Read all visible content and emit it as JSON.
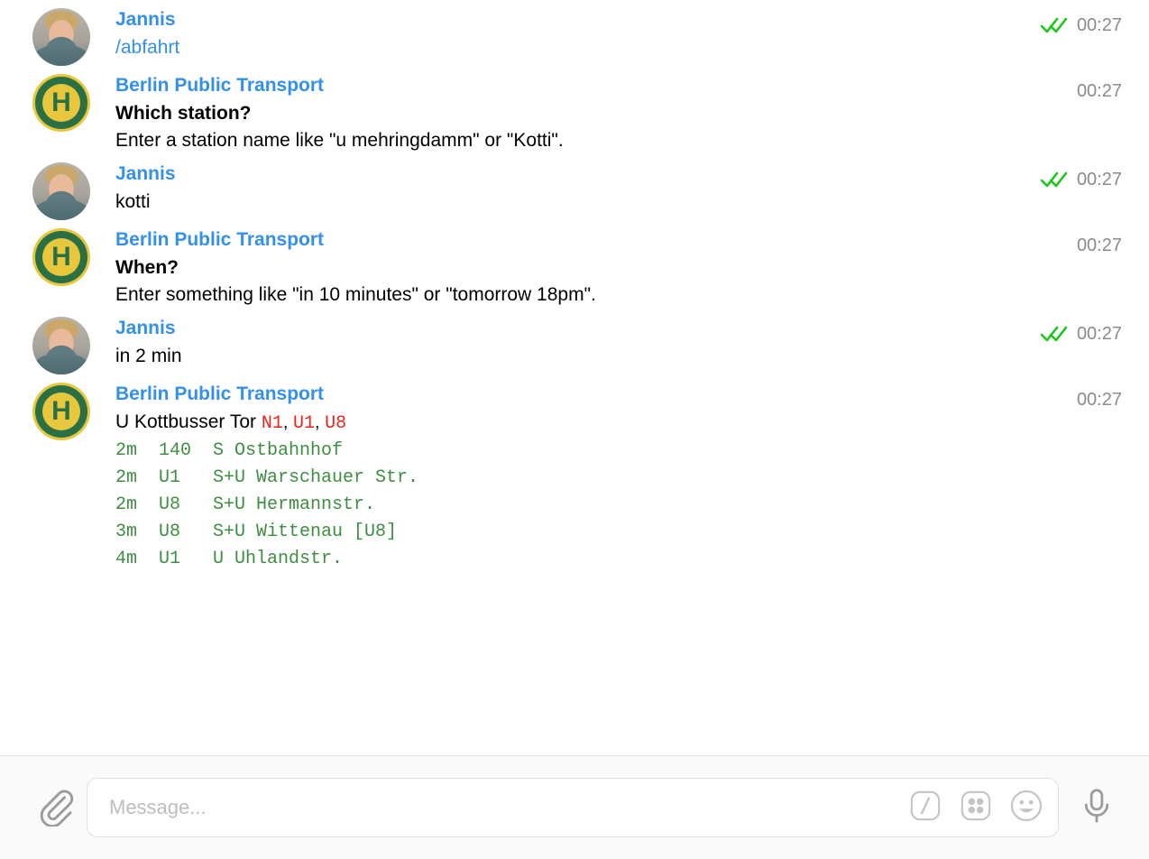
{
  "messages": [
    {
      "sender": "Jannis",
      "avatar": "photo-avatar",
      "text": "/abfahrt",
      "style": "command",
      "time": "00:27",
      "read": true
    },
    {
      "sender": "Berlin Public Transport",
      "avatar": "bus-stop-h-icon",
      "title": "Which station?",
      "text": "Enter a station name like \"u mehringdamm\" or \"Kotti\".",
      "style": "bot-prompt",
      "time": "00:27",
      "read": false
    },
    {
      "sender": "Jannis",
      "avatar": "photo-avatar",
      "text": "kotti",
      "style": "plain",
      "time": "00:27",
      "read": true
    },
    {
      "sender": "Berlin Public Transport",
      "avatar": "bus-stop-h-icon",
      "title": "When?",
      "text": "Enter something like \"in 10 minutes\" or \"tomorrow 18pm\".",
      "style": "bot-prompt",
      "time": "00:27",
      "read": false
    },
    {
      "sender": "Jannis",
      "avatar": "photo-avatar",
      "text": "in 2 min",
      "style": "plain",
      "time": "00:27",
      "read": true
    },
    {
      "sender": "Berlin Public Transport",
      "avatar": "bus-stop-h-icon",
      "style": "departures",
      "time": "00:27",
      "read": false,
      "departures": {
        "station": "U Kottbusser Tor",
        "lines_label": "N1, U1, U8",
        "lines": [
          "N1",
          "U1",
          "U8"
        ],
        "columns": [
          "when",
          "line",
          "destination"
        ],
        "rows": [
          {
            "when": "2m",
            "line": "140",
            "destination": "S Ostbahnhof"
          },
          {
            "when": "2m",
            "line": "U1",
            "destination": "S+U Warschauer Str."
          },
          {
            "when": "2m",
            "line": "U8",
            "destination": "S+U Hermannstr."
          },
          {
            "when": "3m",
            "line": "U8",
            "destination": "S+U Wittenau [U8]"
          },
          {
            "when": "4m",
            "line": "U1",
            "destination": "U Uhlandstr."
          }
        ]
      }
    }
  ],
  "composer": {
    "placeholder": "Message...",
    "value": "",
    "attach_icon": "paperclip-icon",
    "command_icon": "slash-command-icon",
    "keyboard_icon": "bot-keyboard-icon",
    "emoji_icon": "smiley-icon",
    "mic_icon": "microphone-icon"
  },
  "colors": {
    "sender_blue": "#3390ec",
    "command_blue": "#3390ec",
    "departure_green": "#3e8e41",
    "line_red": "#e8251b",
    "check_green": "#19c719",
    "time_gray": "#8b8b8b",
    "sign_yellow": "#e8c73c",
    "sign_green": "#2b7045"
  }
}
